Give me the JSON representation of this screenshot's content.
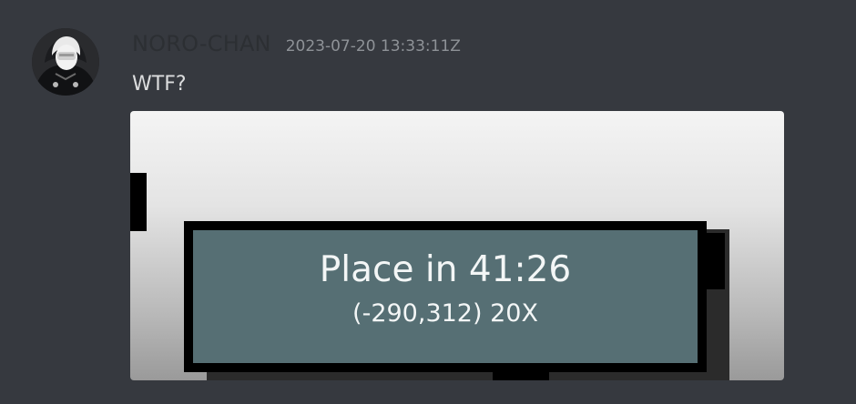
{
  "message": {
    "author": "NORO-CHAN",
    "timestamp": "2023-07-20 13:33:11Z",
    "text": "WTF?",
    "avatar_icon": "user-avatar"
  },
  "attachment": {
    "overlay_title": "Place in 41:26",
    "overlay_subtitle": "(-290,312) 20X"
  },
  "colors": {
    "background": "#36393f",
    "username": "#2c2f33",
    "timestamp": "#8e9297",
    "message_text": "#dcddde",
    "panel_fill": "#566f74",
    "panel_text": "#f3f6f6"
  }
}
